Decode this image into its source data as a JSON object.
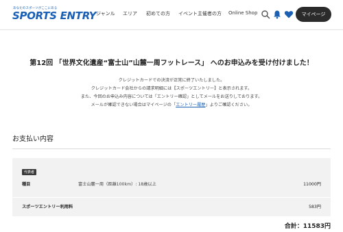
{
  "header": {
    "logo_tagline": "あなたのスポーツがここにある",
    "logo_text": "SPORTS ENTRY",
    "nav": [
      "ジャンル",
      "エリア",
      "初めての方",
      "イベント主催者の方",
      "Online Shop"
    ],
    "icons": [
      "search-icon",
      "bell-icon",
      "heart-icon"
    ],
    "mypage_label": "マイページ",
    "brand_color": "#1a5fb4"
  },
  "confirmation": {
    "title": "第12回 「世界文化遺産“富士山”山麓一周フットレース」 へのお申込みを受け付けました！",
    "messages": [
      "クレジットカードでの決済が正常に終了いたしました。",
      "クレジットカード会社からの請求明細には【スポーツエントリー】と表示されます。",
      "また、今回のお申込み内容については「エントリー確認」としてメールをお送りしております。"
    ],
    "mail_note_prefix": "メールが確認できない場合はマイページの「",
    "mail_note_link": "エントリー履歴",
    "mail_note_suffix": "」よりご確認ください。"
  },
  "payment": {
    "section_title": "お支払い内容",
    "badge": "代表者",
    "item_label": "種目",
    "item_description": "富士山麓一周（距離100km）: 18歳以上",
    "item_price": "11000円",
    "fee_label": "スポーツエントリー利用料",
    "fee_price": "583円",
    "total": "合計：11583円"
  }
}
